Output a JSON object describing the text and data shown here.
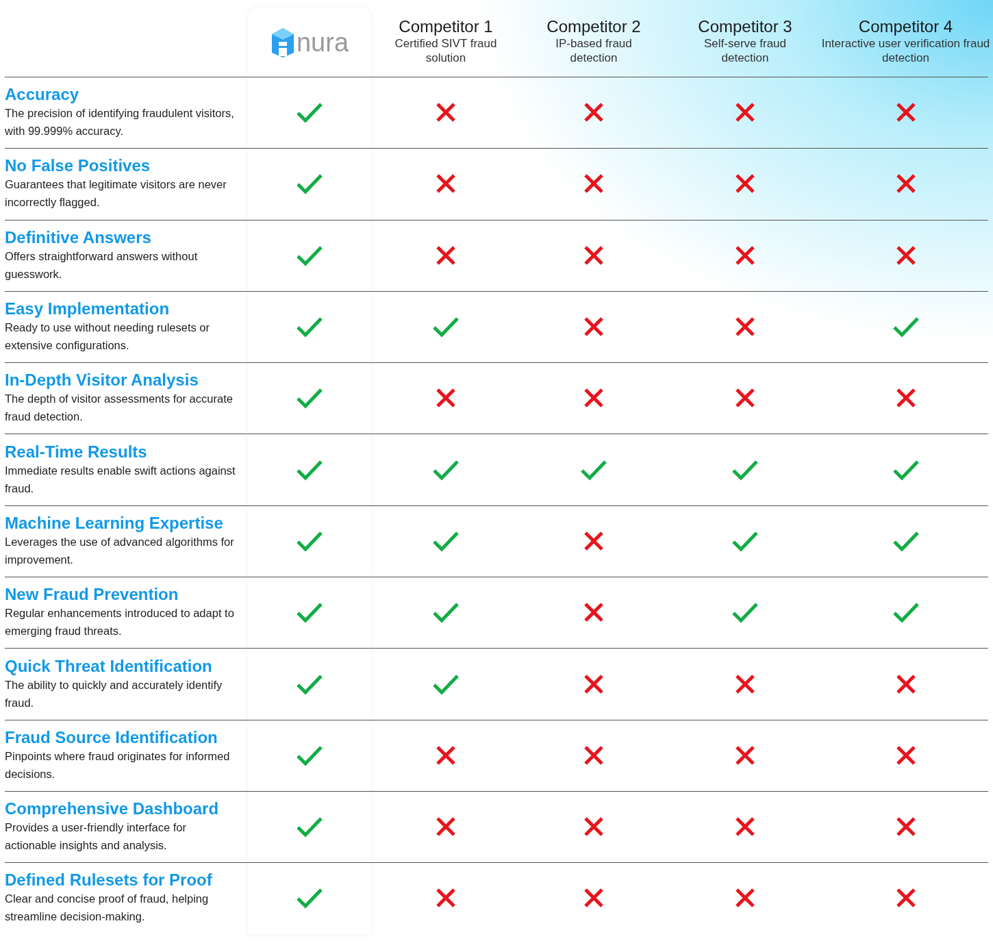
{
  "logo": {
    "text": "nura"
  },
  "competitors": [
    {
      "name": "Competitor 1",
      "subtitle": "Certified SIVT fraud solution"
    },
    {
      "name": "Competitor 2",
      "subtitle": "IP-based fraud detection"
    },
    {
      "name": "Competitor 3",
      "subtitle": "Self-serve fraud detection"
    },
    {
      "name": "Competitor 4",
      "subtitle": "Interactive user verification fraud detection"
    }
  ],
  "rows": [
    {
      "title": "Accuracy",
      "description": "The precision of identifying fraudulent visitors, with 99.999% accuracy.",
      "cells": [
        {
          "supported": true
        },
        {
          "supported": false
        },
        {
          "supported": false
        },
        {
          "supported": false
        },
        {
          "supported": false
        }
      ]
    },
    {
      "title": "No False Positives",
      "description": "Guarantees that legitimate visitors are never incorrectly flagged.",
      "cells": [
        {
          "supported": true
        },
        {
          "supported": false
        },
        {
          "supported": false
        },
        {
          "supported": false
        },
        {
          "supported": false
        }
      ]
    },
    {
      "title": "Definitive Answers",
      "description": "Offers straightforward answers without guesswork.",
      "cells": [
        {
          "supported": true
        },
        {
          "supported": false
        },
        {
          "supported": false
        },
        {
          "supported": false
        },
        {
          "supported": false
        }
      ]
    },
    {
      "title": "Easy Implementation",
      "description": "Ready to use without needing rulesets or extensive configurations.",
      "cells": [
        {
          "supported": true
        },
        {
          "supported": true
        },
        {
          "supported": false
        },
        {
          "supported": false
        },
        {
          "supported": true
        }
      ]
    },
    {
      "title": "In-Depth Visitor Analysis",
      "description": "The depth of visitor assessments for accurate fraud detection.",
      "cells": [
        {
          "supported": true
        },
        {
          "supported": false
        },
        {
          "supported": false
        },
        {
          "supported": false
        },
        {
          "supported": false
        }
      ]
    },
    {
      "title": "Real-Time Results",
      "description": "Immediate results enable swift actions against fraud.",
      "cells": [
        {
          "supported": true
        },
        {
          "supported": true
        },
        {
          "supported": true
        },
        {
          "supported": true
        },
        {
          "supported": true
        }
      ]
    },
    {
      "title": "Machine Learning Expertise",
      "description": "Leverages the use of advanced algorithms for improvement.",
      "cells": [
        {
          "supported": true
        },
        {
          "supported": true
        },
        {
          "supported": false
        },
        {
          "supported": true
        },
        {
          "supported": true
        }
      ]
    },
    {
      "title": "New Fraud Prevention",
      "description": "Regular enhancements introduced to adapt to emerging fraud threats.",
      "cells": [
        {
          "supported": true
        },
        {
          "supported": true
        },
        {
          "supported": false
        },
        {
          "supported": true
        },
        {
          "supported": true
        }
      ]
    },
    {
      "title": "Quick Threat Identification",
      "description": "The ability to quickly and accurately identify fraud.",
      "cells": [
        {
          "supported": true
        },
        {
          "supported": true
        },
        {
          "supported": false
        },
        {
          "supported": false
        },
        {
          "supported": false
        }
      ]
    },
    {
      "title": "Fraud Source Identification",
      "description": "Pinpoints where fraud originates for informed decisions.",
      "cells": [
        {
          "supported": true
        },
        {
          "supported": false
        },
        {
          "supported": false
        },
        {
          "supported": false
        },
        {
          "supported": false
        }
      ]
    },
    {
      "title": "Comprehensive Dashboard",
      "description": "Provides a user-friendly interface for actionable insights and analysis.",
      "cells": [
        {
          "supported": true
        },
        {
          "supported": false
        },
        {
          "supported": false
        },
        {
          "supported": false
        },
        {
          "supported": false
        }
      ]
    },
    {
      "title": "Defined Rulesets for Proof",
      "description": "Clear and concise proof of fraud, helping streamline decision-making.",
      "cells": [
        {
          "supported": true
        },
        {
          "supported": false
        },
        {
          "supported": false
        },
        {
          "supported": false
        },
        {
          "supported": false
        }
      ]
    }
  ]
}
